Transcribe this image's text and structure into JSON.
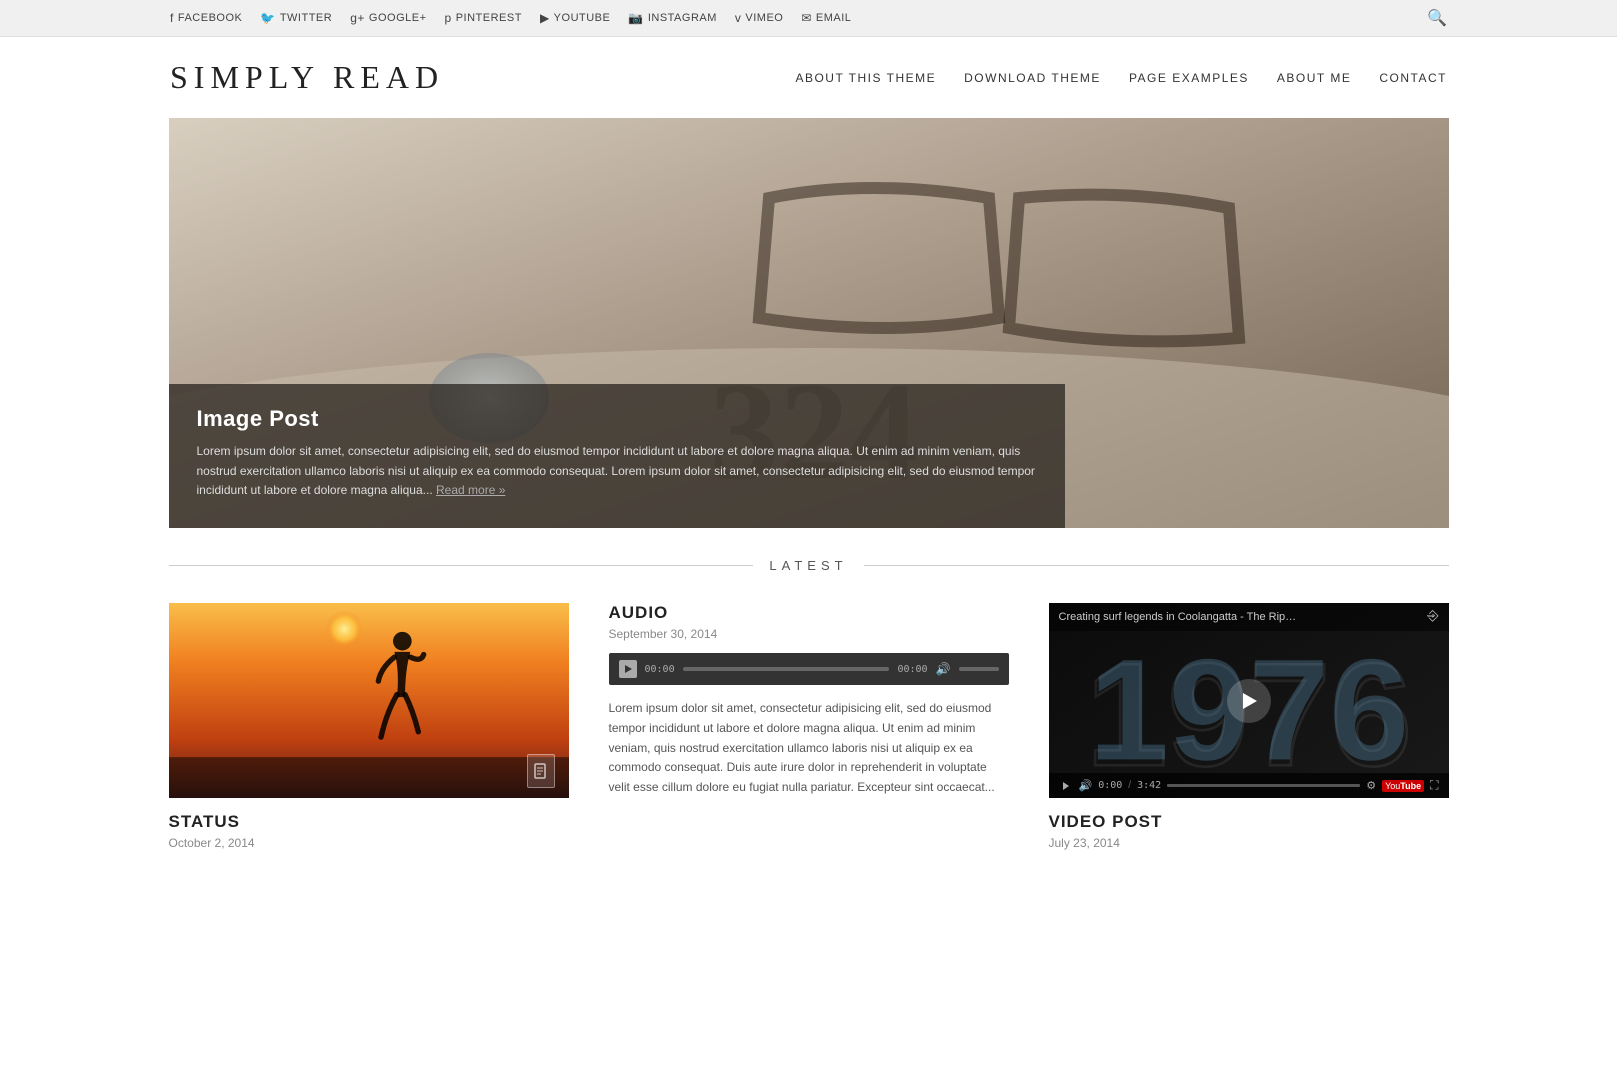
{
  "topbar": {
    "links": [
      {
        "label": "FACEBOOK",
        "icon": "f"
      },
      {
        "label": "TWITTER",
        "icon": "🐦"
      },
      {
        "label": "GOOGLE+",
        "icon": "g+"
      },
      {
        "label": "PINTEREST",
        "icon": "p"
      },
      {
        "label": "YOUTUBE",
        "icon": "▶"
      },
      {
        "label": "INSTAGRAM",
        "icon": "📷"
      },
      {
        "label": "VIMEO",
        "icon": "v"
      },
      {
        "label": "EMAIL",
        "icon": "✉"
      }
    ]
  },
  "header": {
    "site_title": "SIMPLY READ",
    "nav": [
      {
        "label": "ABOUT THIS THEME"
      },
      {
        "label": "DOWNLOAD THEME"
      },
      {
        "label": "PAGE EXAMPLES"
      },
      {
        "label": "ABOUT ME"
      },
      {
        "label": "CONTACT"
      }
    ]
  },
  "hero": {
    "post_title": "Image Post",
    "post_text": "Lorem ipsum dolor sit amet, consectetur adipisicing elit, sed do eiusmod tempor incididunt ut labore et dolore magna aliqua. Ut enim ad minim veniam, quis nostrud exercitation ullamco laboris nisi ut aliquip ex ea commodo consequat. Lorem ipsum dolor sit amet, consectetur adipisicing elit, sed do eiusmod tempor incididunt ut labore et dolore magna aliqua...",
    "read_more": "Read more »"
  },
  "latest": {
    "title": "LATEST"
  },
  "posts": [
    {
      "type": "STATUS",
      "date": "October 2, 2014",
      "has_thumbnail": true
    },
    {
      "type": "AUDIO",
      "date": "September 30, 2014",
      "time_start": "00:00",
      "time_end": "00:00",
      "text": "Lorem ipsum dolor sit amet, consectetur adipisicing elit, sed do eiusmod tempor incididunt ut labore et dolore magna aliqua. Ut enim ad minim veniam, quis nostrud exercitation ullamco laboris nisi ut aliquip ex ea commodo consequat. Duis aute irure dolor in reprehenderit in voluptate velit esse cillum dolore eu fugiat nulla pariatur. Excepteur sint occaecat..."
    },
    {
      "type": "VIDEO POST",
      "date": "July 23, 2014",
      "video_title": "Creating surf legends in Coolangatta - The Ripple Eff...",
      "video_year": "1976",
      "video_time": "0:00",
      "video_duration": "3:42"
    }
  ]
}
